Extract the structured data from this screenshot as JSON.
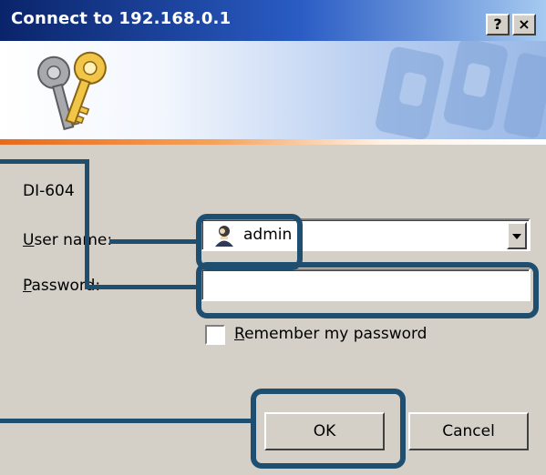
{
  "window": {
    "title": "Connect to 192.168.0.1",
    "help_button": "?",
    "close_button": "×"
  },
  "banner": {
    "icon": "keys-icon"
  },
  "realm": "DI-604",
  "username": {
    "label_accel": "U",
    "label_rest": "ser name:",
    "value": "admin",
    "icon": "user-icon"
  },
  "password": {
    "label_accel": "P",
    "label_rest": "assword:",
    "value": ""
  },
  "remember": {
    "label_accel": "R",
    "label_rest": "emember my password",
    "checked": false
  },
  "buttons": {
    "ok": "OK",
    "cancel": "Cancel"
  },
  "colors": {
    "callout": "#1f4f70",
    "title_start": "#0a246a",
    "accent_orange": "#e66a1c"
  }
}
